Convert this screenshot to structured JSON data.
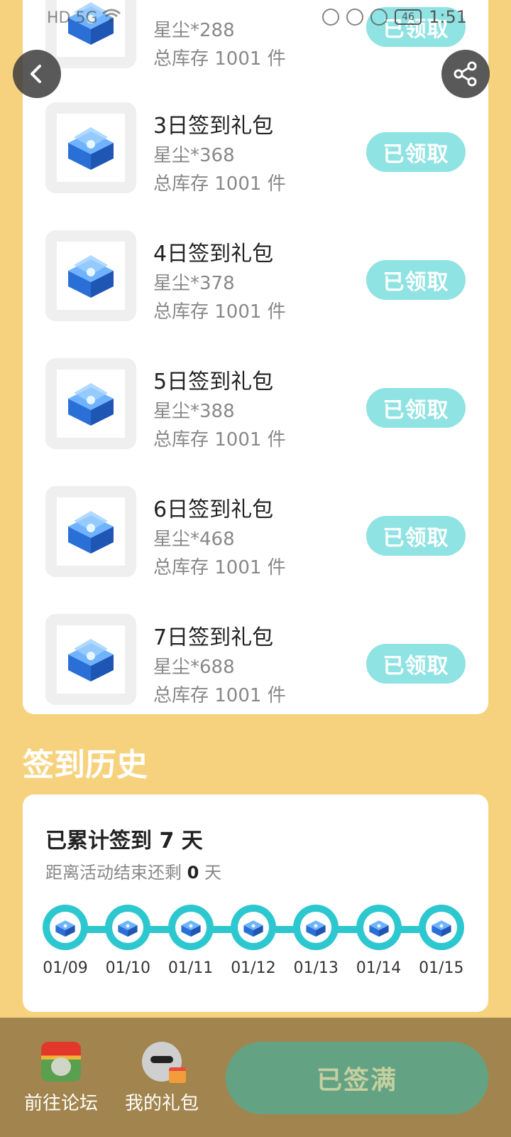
{
  "status_bar": {
    "network": "HD 5G",
    "battery": "46",
    "time": "1:51"
  },
  "colors": {
    "page_bg": "#f7d27e",
    "claimed_button": "#8fe3e3",
    "timeline": "#2cc7cf",
    "bottom_bar": "#a2854e",
    "full_button": "#63a384"
  },
  "gifts": [
    {
      "title": "",
      "reward": "星尘*288",
      "stock": "总库存 1001 件",
      "button": "已领取",
      "partial": true
    },
    {
      "title": "3日签到礼包",
      "reward": "星尘*368",
      "stock": "总库存 1001 件",
      "button": "已领取"
    },
    {
      "title": "4日签到礼包",
      "reward": "星尘*378",
      "stock": "总库存 1001 件",
      "button": "已领取"
    },
    {
      "title": "5日签到礼包",
      "reward": "星尘*388",
      "stock": "总库存 1001 件",
      "button": "已领取"
    },
    {
      "title": "6日签到礼包",
      "reward": "星尘*468",
      "stock": "总库存 1001 件",
      "button": "已领取"
    },
    {
      "title": "7日签到礼包",
      "reward": "星尘*688",
      "stock": "总库存 1001 件",
      "button": "已领取"
    }
  ],
  "history": {
    "heading": "签到历史",
    "total_prefix": "已累计签到",
    "total_days": "7",
    "total_suffix": "天",
    "remaining_prefix": "距离活动结束还剩",
    "remaining_days": "0",
    "remaining_suffix": "天",
    "dates": [
      "01/09",
      "01/10",
      "01/11",
      "01/12",
      "01/13",
      "01/14",
      "01/15"
    ]
  },
  "bottom_nav": {
    "forum_label": "前往论坛",
    "gifts_label": "我的礼包",
    "full_button": "已签满"
  },
  "icons": {
    "back": "chevron-left-icon",
    "share": "share-icon",
    "gift": "treasure-chest-icon"
  }
}
